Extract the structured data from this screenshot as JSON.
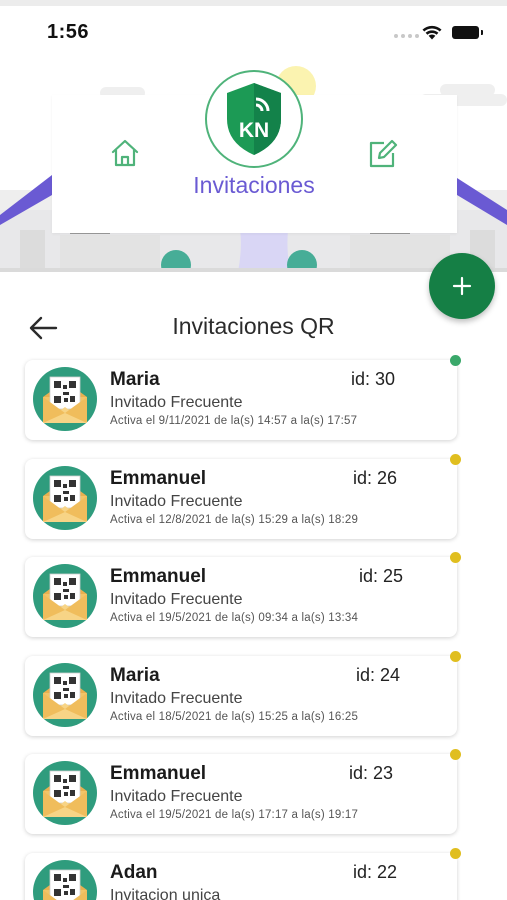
{
  "status_bar": {
    "time": "1:56"
  },
  "header": {
    "title": "Invitaciones",
    "logo_text": "KN"
  },
  "nav": {
    "title": "Invitaciones QR"
  },
  "colors": {
    "accent_green": "#157f45",
    "title_purple": "#6a5ad3",
    "active_dot": "#3aa86a",
    "pending_dot": "#e0be1f"
  },
  "invitations": [
    {
      "name": "Maria",
      "id": "id: 30",
      "type": "Invitado Frecuente",
      "detail": "Activa  el 9/11/2021 de la(s) 14:57 a la(s) 17:57",
      "status": "green"
    },
    {
      "name": "Emmanuel",
      "id": "id: 26",
      "type": "Invitado Frecuente",
      "detail": "Activa  el 12/8/2021 de la(s) 15:29 a la(s) 18:29",
      "status": "yellow"
    },
    {
      "name": "Emmanuel",
      "id": "id: 25",
      "type": "Invitado Frecuente",
      "detail": "Activa  el 19/5/2021 de la(s) 09:34 a la(s) 13:34",
      "status": "yellow"
    },
    {
      "name": "Maria",
      "id": "id: 24",
      "type": "Invitado Frecuente",
      "detail": "Activa  el 18/5/2021 de la(s) 15:25 a la(s) 16:25",
      "status": "yellow"
    },
    {
      "name": "Emmanuel",
      "id": "id: 23",
      "type": "Invitado Frecuente",
      "detail": "Activa  el 19/5/2021 de la(s) 17:17 a la(s) 19:17",
      "status": "yellow"
    },
    {
      "name": "Adan",
      "id": "id: 22",
      "type": "Invitacion unica",
      "detail": "",
      "status": "yellow"
    }
  ]
}
